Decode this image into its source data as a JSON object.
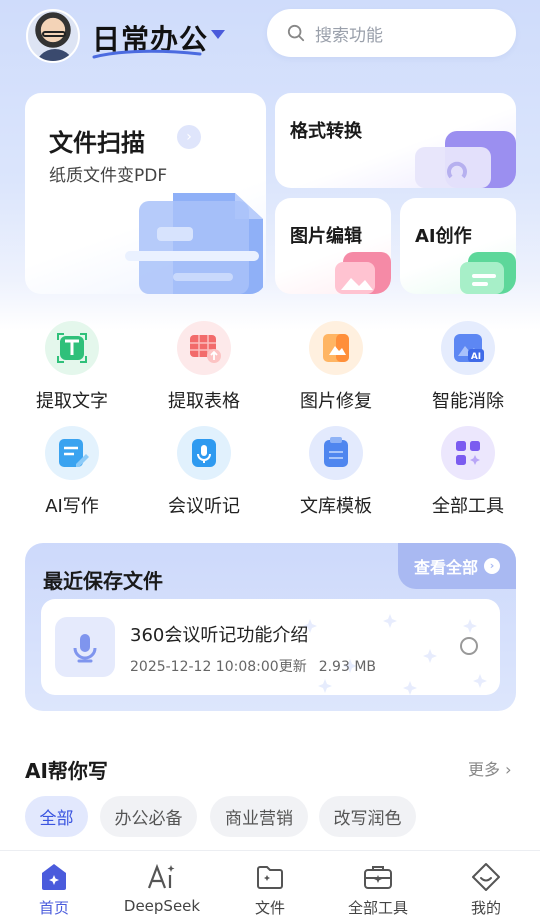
{
  "header": {
    "title": "日常办公",
    "search_placeholder": "搜索功能"
  },
  "cards": {
    "scan_title": "文件扫描",
    "scan_sub": "纸质文件变PDF",
    "convert_title": "格式转换",
    "image_edit_title": "图片编辑",
    "ai_create_title": "AI创作"
  },
  "tools": [
    {
      "label": "提取文字",
      "icon": "text-extract-icon"
    },
    {
      "label": "提取表格",
      "icon": "table-extract-icon"
    },
    {
      "label": "图片修复",
      "icon": "image-repair-icon"
    },
    {
      "label": "智能消除",
      "icon": "ai-erase-icon"
    },
    {
      "label": "AI写作",
      "icon": "ai-write-icon"
    },
    {
      "label": "会议听记",
      "icon": "meeting-record-icon"
    },
    {
      "label": "文库模板",
      "icon": "template-library-icon"
    },
    {
      "label": "全部工具",
      "icon": "all-tools-icon"
    }
  ],
  "recent": {
    "title": "最近保存文件",
    "view_all": "查看全部",
    "file": {
      "name": "360会议听记功能介绍",
      "updated": "2025-12-12 10:08:00更新",
      "size": "2.93 MB"
    }
  },
  "ai_write": {
    "title": "AI帮你写",
    "more": "更多",
    "chips": [
      "全部",
      "办公必备",
      "商业营销",
      "改写润色"
    ]
  },
  "nav": [
    "首页",
    "DeepSeek",
    "文件",
    "全部工具",
    "我的"
  ]
}
